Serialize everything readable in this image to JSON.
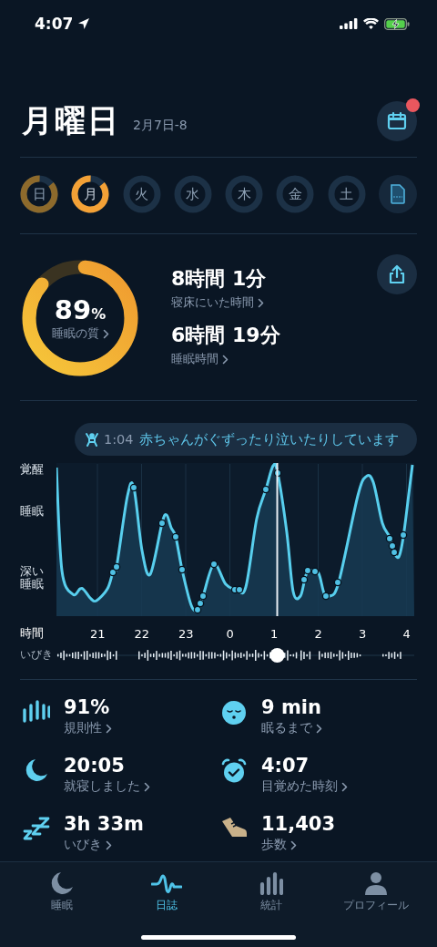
{
  "status_bar": {
    "time": "4:07"
  },
  "header": {
    "title": "月曜日",
    "date_range": "2月7日-8",
    "calendar_badge": true
  },
  "days": [
    {
      "label": "日",
      "recorded": true,
      "selected": false
    },
    {
      "label": "月",
      "recorded": true,
      "selected": true
    },
    {
      "label": "火",
      "recorded": false,
      "selected": false
    },
    {
      "label": "水",
      "recorded": false,
      "selected": false
    },
    {
      "label": "木",
      "recorded": false,
      "selected": false
    },
    {
      "label": "金",
      "recorded": false,
      "selected": false
    },
    {
      "label": "土",
      "recorded": false,
      "selected": false
    }
  ],
  "quality": {
    "score": "89",
    "unit": "%",
    "label": "睡眠の質"
  },
  "durations": [
    {
      "value": "8時間 1分",
      "label": "寝床にいた時間"
    },
    {
      "value": "6時間 19分",
      "label": "睡眠時間"
    }
  ],
  "event": {
    "time": "1:04",
    "text": "赤ちゃんがぐずったり泣いたりしています"
  },
  "chart": {
    "stages": [
      "覚醒",
      "睡眠",
      "深い睡眠"
    ],
    "axis_label": "時間",
    "hours": [
      "21",
      "22",
      "23",
      "0",
      "1",
      "2",
      "3",
      "4"
    ],
    "snore_label": "いびき"
  },
  "stats": [
    {
      "value": "91%",
      "label": "規則性"
    },
    {
      "value": "9 min",
      "label": "眠るまで"
    },
    {
      "value": "20:05",
      "label": "就寝しました"
    },
    {
      "value": "4:07",
      "label": "目覚めた時刻"
    },
    {
      "value": "3h 33m",
      "label": "いびき"
    },
    {
      "value": "11,403",
      "label": "歩数"
    }
  ],
  "tabs": [
    {
      "label": "睡眠",
      "selected": false
    },
    {
      "label": "日誌",
      "selected": true
    },
    {
      "label": "統計",
      "selected": false
    },
    {
      "label": "プロフィール",
      "selected": false
    }
  ]
}
